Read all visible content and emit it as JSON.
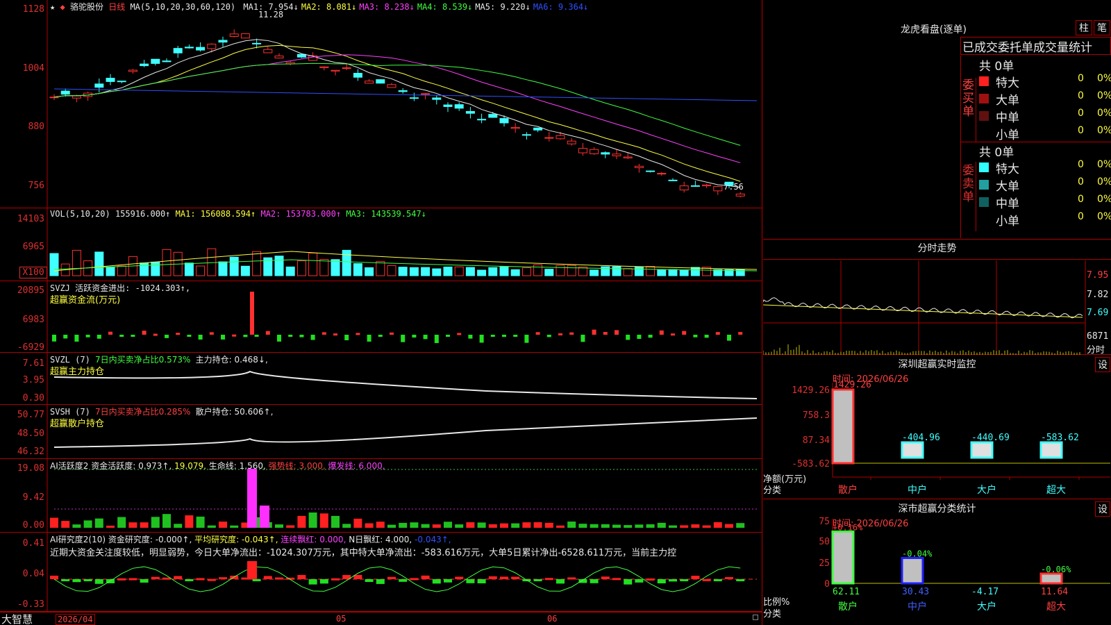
{
  "stock": {
    "star": "★",
    "name": "骆驼股份",
    "period": "日线",
    "ma_label": "MA(5,10,20,30,60,120)",
    "ma": [
      {
        "k": "MA1:",
        "v": "7.954↓",
        "c": "#e8e8e8"
      },
      {
        "k": "MA2:",
        "v": "8.081↓",
        "c": "#ffff40"
      },
      {
        "k": "MA3:",
        "v": "8.238↓",
        "c": "#ff40ff"
      },
      {
        "k": "MA4:",
        "v": "8.539↓",
        "c": "#40ff40"
      },
      {
        "k": "MA5:",
        "v": "9.220↓",
        "c": "#e8e8e8"
      },
      {
        "k": "MA6:",
        "v": "9.364↓",
        "c": "#3050ff"
      }
    ],
    "high_label": "11.28",
    "low_label": "7.56"
  },
  "axes": {
    "price": [
      "1128",
      "1004",
      "880",
      "756"
    ],
    "vol": [
      "14103",
      "6965",
      "X100"
    ],
    "svzj": [
      "20895",
      "6983",
      "-6929"
    ],
    "svzl": [
      "7.61",
      "3.95",
      "0.30"
    ],
    "svsh": [
      "50.77",
      "48.50",
      "46.32"
    ],
    "ai1": [
      "19.08",
      "9.42",
      "0.00"
    ],
    "ai2": [
      "0.41",
      "0.04",
      "-0.33"
    ]
  },
  "vol": {
    "label": "VOL(5,10,20)",
    "val": "155916.000↑",
    "ma1": "MA1: 156088.594↑",
    "ma2": "MA2: 153783.000↑",
    "ma3": "MA3: 143539.547↓"
  },
  "svzj": {
    "label": "SVZJ  活跃资金进出:",
    "val": "-1024.303↑,",
    "sub": "超赢资金流(万元)"
  },
  "svzl": {
    "label": "SVZL (7)",
    "p1": "7日内买卖净占比0.573%",
    "p2": "主力持仓: 0.468↓,",
    "sub": "超赢主力持仓"
  },
  "svsh": {
    "label": "SVSH (7)",
    "p1": "7日内买卖净占比0.285%",
    "p2": "散户持仓: 50.606↑,",
    "sub": "超赢散户持仓"
  },
  "ai1": {
    "label": "AI活跃度2",
    "p1": "资金活跃度: 0.973↑,",
    "p2": "19.079,",
    "p3": "生命线: 1.560,",
    "p4": "强势线: 3.000,",
    "p5": "爆发线: 6.000,"
  },
  "ai2": {
    "label": "AI研究度2(10)",
    "p1": "资金研究度: -0.000↑,",
    "p2": "平均研究度: -0.043↑,",
    "p3": "连续飘红: 0.000,",
    "p4": "N日飘红: 4.000,",
    "p5": "-0.043↑,",
    "text": "近期大资金关注度较低，明显弱势，今日大单净流出：-1024.307万元，其中特大单净流出：-583.616万元，大单5日累计净出-6528.611万元，当前主力控"
  },
  "bottom": {
    "logo": "大智慧",
    "date": "2026/04",
    "m5": "05",
    "m6": "06"
  },
  "lhb": {
    "title": "龙虎看盘(逐单)",
    "btn1": "柱",
    "btn2": "笔",
    "subtitle": "已成交委托单成交量统计",
    "buy": {
      "side": "委买单",
      "total": "共 0单",
      "rows": [
        {
          "n": "特大",
          "v": "0",
          "p": "0%",
          "c": "#ff2020"
        },
        {
          "n": "大单",
          "v": "0",
          "p": "0%",
          "c": "#a01010"
        },
        {
          "n": "中单",
          "v": "0",
          "p": "0%",
          "c": "#601010"
        },
        {
          "n": "小单",
          "v": "0",
          "p": "0%",
          "c": "#000"
        }
      ]
    },
    "sell": {
      "side": "委卖单",
      "total": "共 0单",
      "rows": [
        {
          "n": "特大",
          "v": "0",
          "p": "0%",
          "c": "#30ffff"
        },
        {
          "n": "大单",
          "v": "0",
          "p": "0%",
          "c": "#20a0a0"
        },
        {
          "n": "中单",
          "v": "0",
          "p": "0%",
          "c": "#106060"
        },
        {
          "n": "小单",
          "v": "0",
          "p": "0%",
          "c": "#000"
        }
      ]
    }
  },
  "fs": {
    "title": "分时走势",
    "p1": "7.95",
    "p2": "7.82",
    "p3": "7.69",
    "v": "6871",
    "vl": "分时"
  },
  "monitor": {
    "title": "深圳超赢实时监控",
    "btn": "设",
    "time": "时间: 2026/06/26",
    "axis": [
      "1429.26",
      "758.3",
      "87.34",
      "-583.62"
    ],
    "bars": [
      {
        "label": "1429.26",
        "value": 1429.26,
        "cat": "散户"
      },
      {
        "label": "-404.96",
        "value": -404.96,
        "cat": "中户"
      },
      {
        "label": "-440.69",
        "value": -440.69,
        "cat": "大户"
      },
      {
        "label": "-583.62",
        "value": -583.62,
        "cat": "超大"
      }
    ],
    "yl1": "净额(万元)",
    "yl2": "分类"
  },
  "classify": {
    "title": "深市超赢分类统计",
    "btn": "设",
    "time": "时间: 2026/06/26",
    "axis": [
      "75",
      "50",
      "25",
      "0"
    ],
    "bars": [
      {
        "top": "+0.16%",
        "bottom": "62.11",
        "value": 62.11,
        "cat": "散户",
        "c": "#e03030"
      },
      {
        "top": "-0.04%",
        "bottom": "30.43",
        "value": 30.43,
        "cat": "中户",
        "c": "#2020ff"
      },
      {
        "top": "",
        "bottom": "-4.17",
        "value": 0,
        "cat": "大户",
        "c": "#40ff40"
      },
      {
        "top": "-0.06%",
        "bottom": "11.64",
        "value": 11.64,
        "cat": "超大",
        "c": "#ff3030"
      }
    ],
    "yl1": "比例%",
    "yl2": "分类"
  }
}
